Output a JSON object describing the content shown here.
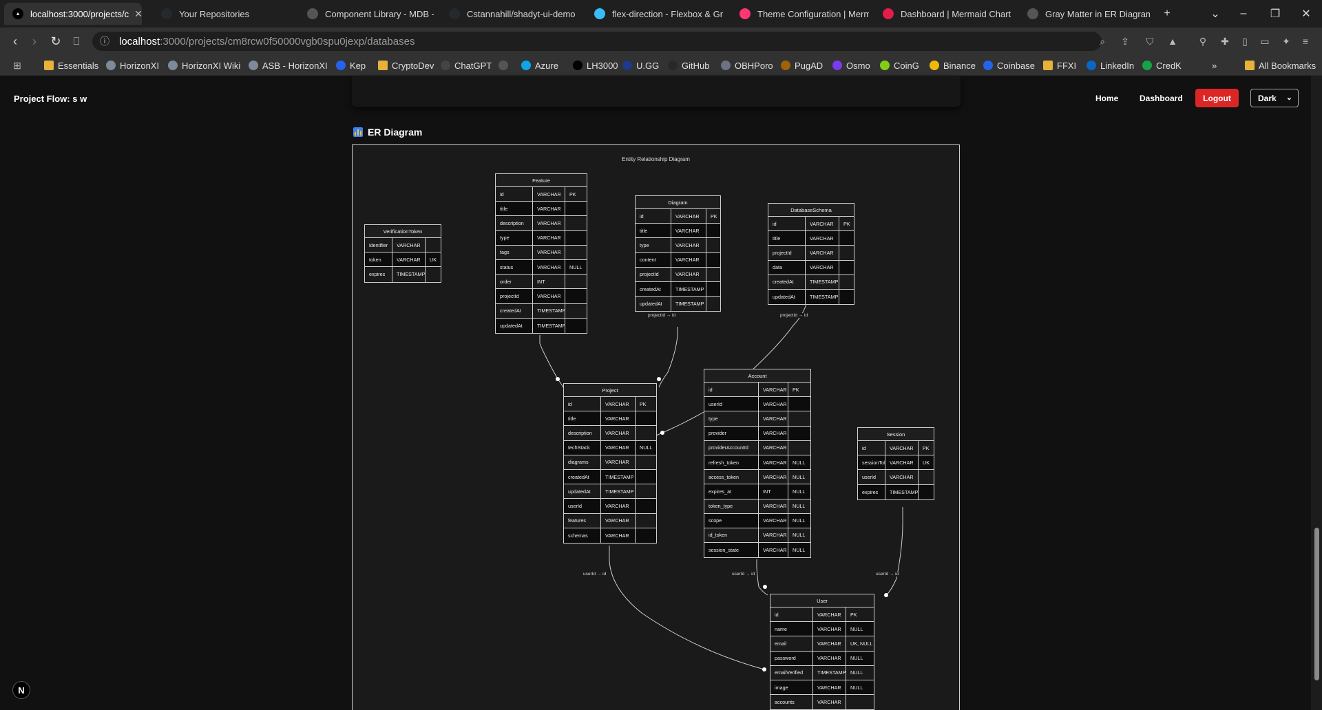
{
  "browser": {
    "tabs": [
      {
        "title": "localhost:3000/projects/c",
        "icon": "next-icon",
        "color": "#000000",
        "active": true
      },
      {
        "title": "Your Repositories",
        "icon": "github-icon",
        "color": "#24292e"
      },
      {
        "title": "Component Library - MDB - sh",
        "icon": "globe-icon",
        "color": "#555555"
      },
      {
        "title": "Cstannahill/shadyt-ui-demo",
        "icon": "github-icon",
        "color": "#24292e"
      },
      {
        "title": "flex-direction - Flexbox & Grid",
        "icon": "tailwind-icon",
        "color": "#38bdf8"
      },
      {
        "title": "Theme Configuration | Merma",
        "icon": "mermaid-icon",
        "color": "#ff3670"
      },
      {
        "title": "Dashboard | Mermaid Chart",
        "icon": "mermaid-icon",
        "color": "#e11d48"
      },
      {
        "title": "Gray Matter in ER Diagram",
        "icon": "globe-icon",
        "color": "#555555"
      }
    ],
    "url_host": "localhost",
    "url_path": ":3000/projects/cm8rcw0f50000vgb0spu0jexp/databases",
    "bookmarks": [
      {
        "label": "Essentials",
        "kind": "folder"
      },
      {
        "label": "HorizonXI",
        "kind": "site",
        "color": "#7c8a9a"
      },
      {
        "label": "HorizonXI Wiki",
        "kind": "site",
        "color": "#7c8a9a"
      },
      {
        "label": "ASB - HorizonXI",
        "kind": "site",
        "color": "#7c8a9a"
      },
      {
        "label": "Kep",
        "kind": "site",
        "color": "#2563eb"
      },
      {
        "label": "CryptoDev",
        "kind": "folder"
      },
      {
        "label": "ChatGPT",
        "kind": "site",
        "color": "#444444"
      },
      {
        "label": "",
        "kind": "site",
        "color": "#555555"
      },
      {
        "label": "Azure",
        "kind": "site",
        "color": "#0ea5e9"
      },
      {
        "label": "LH3000",
        "kind": "site",
        "color": "#000000"
      },
      {
        "label": "U.GG",
        "kind": "site",
        "color": "#1e3a8a"
      },
      {
        "label": "GitHub",
        "kind": "site",
        "color": "#24292e"
      },
      {
        "label": "OBHPoro",
        "kind": "site",
        "color": "#6b7280"
      },
      {
        "label": "PugAD",
        "kind": "site",
        "color": "#a16207"
      },
      {
        "label": "Osmo",
        "kind": "site",
        "color": "#7c3aed"
      },
      {
        "label": "CoinG",
        "kind": "site",
        "color": "#84cc16"
      },
      {
        "label": "Binance",
        "kind": "site",
        "color": "#f0b90b"
      },
      {
        "label": "Coinbase",
        "kind": "site",
        "color": "#2563eb"
      },
      {
        "label": "FFXI",
        "kind": "folder"
      },
      {
        "label": "LinkedIn",
        "kind": "site",
        "color": "#0a66c2"
      },
      {
        "label": "CredK",
        "kind": "site",
        "color": "#16a34a"
      }
    ],
    "bookmarks_overflow": "»",
    "all_bookmarks": "All Bookmarks"
  },
  "app": {
    "brand": "Project Flow: s w",
    "nav": [
      "Home",
      "Dashboard"
    ],
    "logout": "Logout",
    "theme": "Dark",
    "section_title": "ER Diagram",
    "next_badge": "N"
  },
  "diagram": {
    "title": "Entity Relationship Diagram",
    "relations": [
      "projectId → id",
      "projectId → id",
      "projectId → id",
      "userId → id",
      "userId → id",
      "userId → id"
    ],
    "entities": [
      {
        "name": "Feature",
        "rows": [
          [
            "id",
            "VARCHAR",
            "PK"
          ],
          [
            "title",
            "VARCHAR",
            ""
          ],
          [
            "description",
            "VARCHAR",
            ""
          ],
          [
            "type",
            "VARCHAR",
            ""
          ],
          [
            "tags",
            "VARCHAR",
            ""
          ],
          [
            "status",
            "VARCHAR",
            "NULL"
          ],
          [
            "order",
            "INT",
            ""
          ],
          [
            "projectId",
            "VARCHAR",
            ""
          ],
          [
            "createdAt",
            "TIMESTAMP",
            ""
          ],
          [
            "updatedAt",
            "TIMESTAMP",
            ""
          ]
        ]
      },
      {
        "name": "Diagram",
        "rows": [
          [
            "id",
            "VARCHAR",
            "PK"
          ],
          [
            "title",
            "VARCHAR",
            ""
          ],
          [
            "type",
            "VARCHAR",
            ""
          ],
          [
            "content",
            "VARCHAR",
            ""
          ],
          [
            "projectId",
            "VARCHAR",
            ""
          ],
          [
            "createdAt",
            "TIMESTAMP",
            ""
          ],
          [
            "updatedAt",
            "TIMESTAMP",
            ""
          ]
        ]
      },
      {
        "name": "DatabaseSchema",
        "rows": [
          [
            "id",
            "VARCHAR",
            "PK"
          ],
          [
            "title",
            "VARCHAR",
            ""
          ],
          [
            "projectId",
            "VARCHAR",
            ""
          ],
          [
            "data",
            "VARCHAR",
            ""
          ],
          [
            "createdAt",
            "TIMESTAMP",
            ""
          ],
          [
            "updatedAt",
            "TIMESTAMP",
            ""
          ]
        ]
      },
      {
        "name": "VerificationToken",
        "rows": [
          [
            "identifier",
            "VARCHAR",
            ""
          ],
          [
            "token",
            "VARCHAR",
            "UK"
          ],
          [
            "expires",
            "TIMESTAMP",
            ""
          ]
        ]
      },
      {
        "name": "Project",
        "rows": [
          [
            "id",
            "VARCHAR",
            "PK"
          ],
          [
            "title",
            "VARCHAR",
            ""
          ],
          [
            "description",
            "VARCHAR",
            ""
          ],
          [
            "techStack",
            "VARCHAR",
            "NULL"
          ],
          [
            "diagrams",
            "VARCHAR",
            ""
          ],
          [
            "createdAt",
            "TIMESTAMP",
            ""
          ],
          [
            "updatedAt",
            "TIMESTAMP",
            ""
          ],
          [
            "userId",
            "VARCHAR",
            ""
          ],
          [
            "features",
            "VARCHAR",
            ""
          ],
          [
            "schemas",
            "VARCHAR",
            ""
          ]
        ]
      },
      {
        "name": "Account",
        "rows": [
          [
            "id",
            "VARCHAR",
            "PK"
          ],
          [
            "userId",
            "VARCHAR",
            ""
          ],
          [
            "type",
            "VARCHAR",
            ""
          ],
          [
            "provider",
            "VARCHAR",
            ""
          ],
          [
            "providerAccountId",
            "VARCHAR",
            ""
          ],
          [
            "refresh_token",
            "VARCHAR",
            "NULL"
          ],
          [
            "access_token",
            "VARCHAR",
            "NULL"
          ],
          [
            "expires_at",
            "INT",
            "NULL"
          ],
          [
            "token_type",
            "VARCHAR",
            "NULL"
          ],
          [
            "scope",
            "VARCHAR",
            "NULL"
          ],
          [
            "id_token",
            "VARCHAR",
            "NULL"
          ],
          [
            "session_state",
            "VARCHAR",
            "NULL"
          ]
        ]
      },
      {
        "name": "Session",
        "rows": [
          [
            "id",
            "VARCHAR",
            "PK"
          ],
          [
            "sessionToken",
            "VARCHAR",
            "UK"
          ],
          [
            "userId",
            "VARCHAR",
            ""
          ],
          [
            "expires",
            "TIMESTAMP",
            ""
          ]
        ]
      },
      {
        "name": "User",
        "rows": [
          [
            "id",
            "VARCHAR",
            "PK"
          ],
          [
            "name",
            "VARCHAR",
            "NULL"
          ],
          [
            "email",
            "VARCHAR",
            "UK, NULL"
          ],
          [
            "password",
            "VARCHAR",
            "NULL"
          ],
          [
            "emailVerified",
            "TIMESTAMP",
            "NULL"
          ],
          [
            "image",
            "VARCHAR",
            "NULL"
          ],
          [
            "accounts",
            "VARCHAR",
            ""
          ]
        ]
      }
    ]
  }
}
